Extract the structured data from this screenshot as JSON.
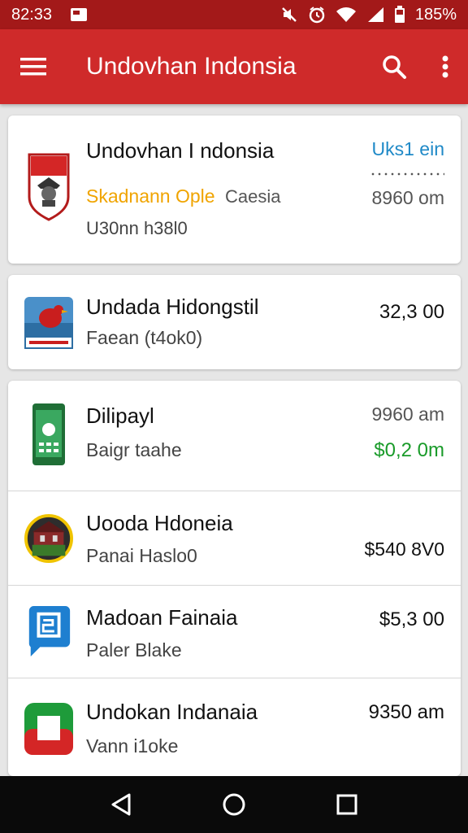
{
  "status_bar": {
    "time": "82:33",
    "battery": "185%",
    "icons": [
      "notification-icon",
      "mute-icon",
      "alarm-icon",
      "wifi-icon",
      "signal-icon",
      "battery-icon"
    ]
  },
  "app_bar": {
    "title": "Undovhan Indonsia",
    "background": "#cf2a2a",
    "icons": [
      "menu-icon",
      "search-icon",
      "more-vert-icon"
    ]
  },
  "list": {
    "items": [
      {
        "title": "Undovhan I ndonsia",
        "subtitle_accent": "Skadnann Ople",
        "subtitle_rest": "Caesia",
        "subtitle2": "U30nn h38l0",
        "right_top": "Uks1 ein",
        "right_bottom": "8960 om",
        "icon": "shield-crest-icon"
      },
      {
        "title": "Undada Hidongstil",
        "subtitle": "Faean (t4ok0)",
        "right": "32,3 00",
        "icon": "bird-icon"
      },
      {
        "title": "Dilipayl",
        "subtitle": "Baigr taahe",
        "right_top": "9960 am",
        "right_bottom": "$0,2 0m",
        "icon": "phone-icon"
      },
      {
        "title": "Uooda Hdoneia",
        "subtitle": "Panai Haslo0",
        "right": "$540 8V0",
        "icon": "house-icon"
      },
      {
        "title": "Madoan Fainaia",
        "subtitle": "Paler Blake",
        "right": "$5,3 00",
        "icon": "chat-icon"
      },
      {
        "title": "Undokan Indanaia",
        "subtitle": "Vann i1oke",
        "right": "9350 am",
        "icon": "flag-icon"
      }
    ]
  },
  "colors": {
    "status_bar": "#a31919",
    "accent_orange": "#f0a400",
    "accent_blue": "#1f89c7",
    "accent_green": "#1a9b2a"
  },
  "nav_bar": {
    "icons": [
      "back-icon",
      "home-icon",
      "recents-icon"
    ]
  }
}
